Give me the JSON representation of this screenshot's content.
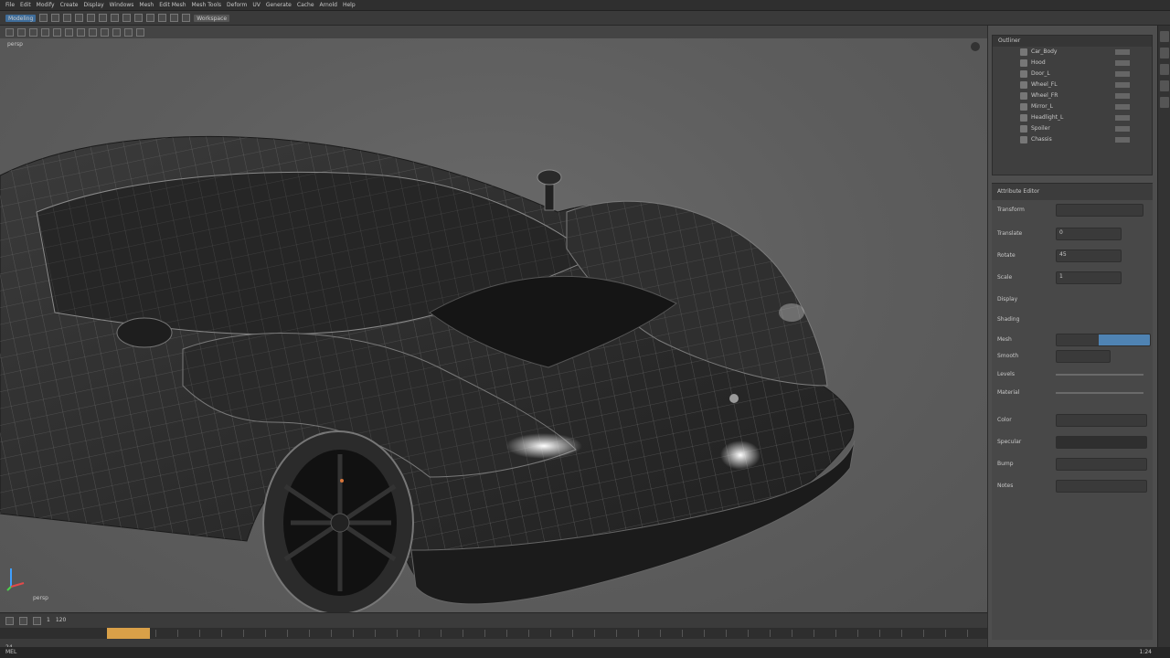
{
  "menubar": {
    "items": [
      "File",
      "Edit",
      "Modify",
      "Create",
      "Display",
      "Windows",
      "Mesh",
      "Edit Mesh",
      "Mesh Tools",
      "Deform",
      "UV",
      "Generate",
      "Cache",
      "Arnold",
      "Help"
    ]
  },
  "toolbar": {
    "mode": "Modeling",
    "workspace": "Workspace"
  },
  "viewport": {
    "label": "persp",
    "stats": "persp",
    "object": "sports car wireframe model"
  },
  "outliner": {
    "title": "Outliner",
    "rows": [
      "Car_Body",
      "Hood",
      "Door_L",
      "Wheel_FL",
      "Wheel_FR",
      "Mirror_L",
      "Headlight_L",
      "Spoiler",
      "Chassis"
    ]
  },
  "properties": {
    "title": "Attribute Editor",
    "rows": [
      {
        "label": "Transform",
        "value": ""
      },
      {
        "label": "Translate",
        "value": "0"
      },
      {
        "label": "Rotate",
        "value": "45"
      },
      {
        "label": "Scale",
        "value": "1"
      },
      {
        "label": "Display",
        "value": ""
      },
      {
        "label": "Shading",
        "value": ""
      },
      {
        "label": "Mesh",
        "value": ""
      },
      {
        "label": "Smooth",
        "value": ""
      },
      {
        "label": "Levels",
        "value": ""
      },
      {
        "label": "Material",
        "value": ""
      },
      {
        "label": "Color",
        "value": ""
      },
      {
        "label": "Specular",
        "value": ""
      },
      {
        "label": "Bump",
        "value": ""
      },
      {
        "label": "Notes",
        "value": ""
      }
    ]
  },
  "timeline": {
    "start": "1",
    "end": "120",
    "current": "24"
  },
  "status": {
    "left": "MEL",
    "right": "1:24"
  },
  "colors": {
    "accent": "#d9a048",
    "selection": "#4f83b3",
    "viewport_bg": "#5d5d5d",
    "panel_bg": "#4e4e4e"
  }
}
